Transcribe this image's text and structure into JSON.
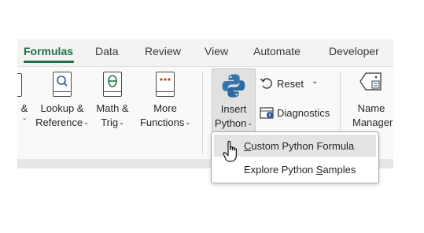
{
  "tabs": [
    {
      "label": "Formulas",
      "active": true
    },
    {
      "label": "Data",
      "active": false
    },
    {
      "label": "Review",
      "active": false
    },
    {
      "label": "View",
      "active": false
    },
    {
      "label": "Automate",
      "active": false
    },
    {
      "label": "Developer",
      "active": false
    }
  ],
  "commands": {
    "partial_text": {
      "line1": "&",
      "line2": "ˇ"
    },
    "lookup": {
      "line1": "Lookup &",
      "line2": "Reference",
      "icon": "lookup-reference-icon"
    },
    "math": {
      "line1": "Math &",
      "line2": "Trig",
      "icon": "math-trig-icon"
    },
    "more": {
      "line1": "More",
      "line2": "Functions",
      "icon": "more-functions-icon"
    },
    "insert_python": {
      "line1": "Insert",
      "line2": "Python",
      "icon": "python-logo-icon"
    },
    "reset": {
      "label": "Reset",
      "icon": "undo-reset-icon"
    },
    "diagnostics": {
      "label": "Diagnostics",
      "icon": "diagnostics-icon"
    },
    "name_manager": {
      "line1": "Name",
      "line2": "Manager",
      "icon": "name-manager-icon"
    }
  },
  "dropdown": {
    "items": [
      {
        "accel": "C",
        "rest": "ustom Python Formula",
        "highlighted": true
      },
      {
        "prefix": "Explore Python ",
        "accel": "S",
        "rest": "amples",
        "highlighted": false
      }
    ]
  },
  "colors": {
    "accent": "#1e7145",
    "python_blue": "#3776ab",
    "python_yellow": "#ffd43b",
    "math_green": "#217346",
    "more_red": "#c43e1c",
    "lookup_blue": "#2b579a"
  }
}
